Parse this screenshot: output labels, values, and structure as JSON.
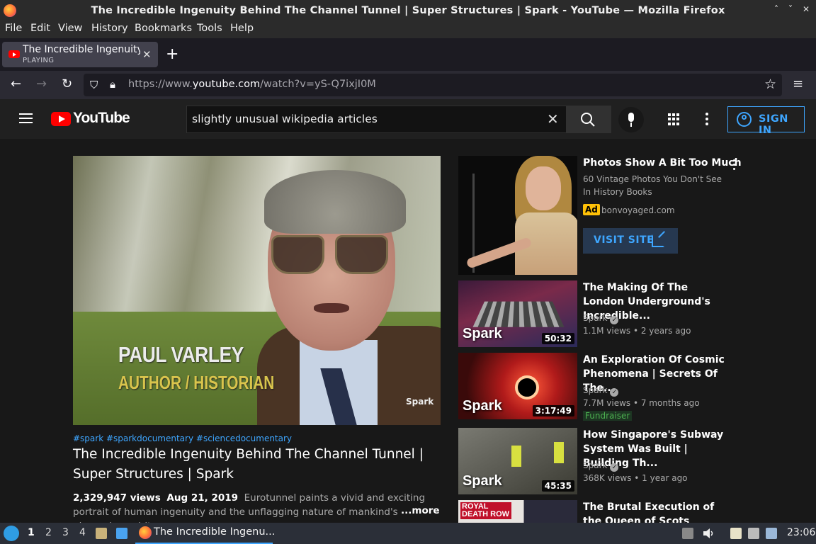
{
  "window": {
    "title": "The Incredible Ingenuity Behind The Channel Tunnel | Super Structures | Spark - YouTube — Mozilla Firefox",
    "controls": [
      "˄",
      "˅",
      "✕"
    ]
  },
  "menu": [
    "File",
    "Edit",
    "View",
    "History",
    "Bookmarks",
    "Tools",
    "Help"
  ],
  "tab": {
    "title": "The Incredible Ingenuity",
    "status": "PLAYING",
    "close": "✕",
    "new_tab": "+"
  },
  "nav": {
    "back": "←",
    "forward": "→",
    "reload": "↻",
    "url_prefix": "https://www.",
    "url_host": "youtube.com",
    "url_path": "/watch?v=yS-Q7ixjI0M",
    "bookmark": "☆",
    "menu": "≡"
  },
  "youtube": {
    "logo_text": "YouTube",
    "search_query": "slightly unusual wikipedia articles",
    "search_clear": "✕",
    "search_icon": "⌕",
    "sign_in": "SIGN IN"
  },
  "video": {
    "caption_name": "PAUL VARLEY",
    "caption_role": "AUTHOR / HISTORIAN",
    "watermark": "Spark",
    "tags": "#spark #sparkdocumentary #sciencedocumentary",
    "title": "The Incredible Ingenuity Behind The Channel Tunnel | Super Structures | Spark",
    "views": "2,329,947 views",
    "date": "Aug 21, 2019",
    "description": "Eurotunnel paints a vivid and exciting portrait of human ingenuity and the unflagging nature of mankind's pioneering spirit.",
    "more": "...more"
  },
  "ad": {
    "title": "Photos Show A Bit Too Much",
    "description": "60 Vintage Photos You Don't See In History Books",
    "badge": "Ad",
    "domain": "bonvoyaged.com",
    "cta": "VISIT SITE"
  },
  "recommendations": [
    {
      "title": "The Making Of The London Underground's Incredible...",
      "channel": "Spark",
      "stats": "1.1M views • 2 years ago",
      "duration": "50:32",
      "overlay": "Spark",
      "badge": ""
    },
    {
      "title": "An Exploration Of Cosmic Phenomena | Secrets Of The...",
      "channel": "Spark",
      "stats": "7.7M views • 7 months ago",
      "duration": "3:17:49",
      "overlay": "Spark",
      "badge": "Fundraiser"
    },
    {
      "title": "How Singapore's Subway System Was Built | Building Th...",
      "channel": "Spark",
      "stats": "368K views • 1 year ago",
      "duration": "45:35",
      "overlay": "Spark",
      "badge": ""
    },
    {
      "title": "The Brutal Execution of the Queen of Scots",
      "channel": "",
      "stats": "",
      "duration": "",
      "overlay": "ROYAL DEATH ROW",
      "badge": ""
    }
  ],
  "taskbar": {
    "workspaces": [
      "1",
      "2",
      "3",
      "4"
    ],
    "task_label": "The Incredible Ingenu...",
    "clock": "23:06"
  },
  "colors": {
    "accent_blue": "#3ea6ff",
    "youtube_red": "#ff0000",
    "background": "#181818"
  }
}
